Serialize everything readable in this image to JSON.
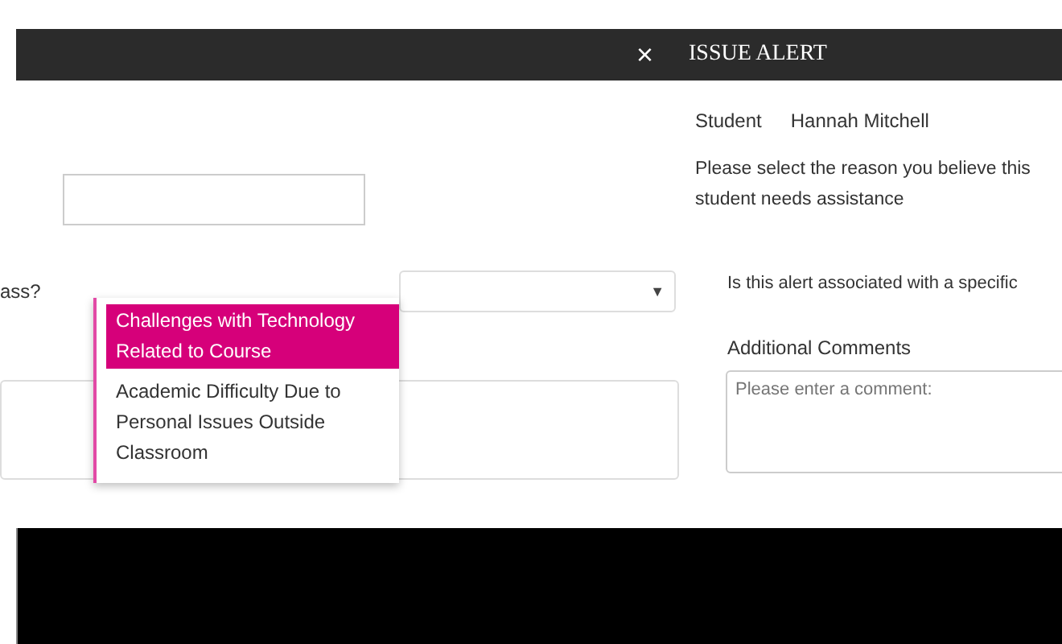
{
  "left_panel": {
    "close": "×",
    "label": "ass?",
    "select": {
      "arrow": "▼"
    },
    "dropdown": {
      "options": [
        {
          "label": "Challenges with Technology Related to Course",
          "selected": true
        },
        {
          "label": "Academic Difficulty Due to Personal Issues Outside Classroom",
          "selected": false
        }
      ]
    }
  },
  "issue_alert": {
    "title": "ISSUE ALERT",
    "student_label": "Student",
    "student_name": "Hannah Mitchell",
    "instructions": "Please select the reason you believe this student needs assistance",
    "question": "Is this alert associated with a specific",
    "comments_label": "Additional Comments",
    "comments": {
      "placeholder": "Please enter a comment:"
    }
  }
}
